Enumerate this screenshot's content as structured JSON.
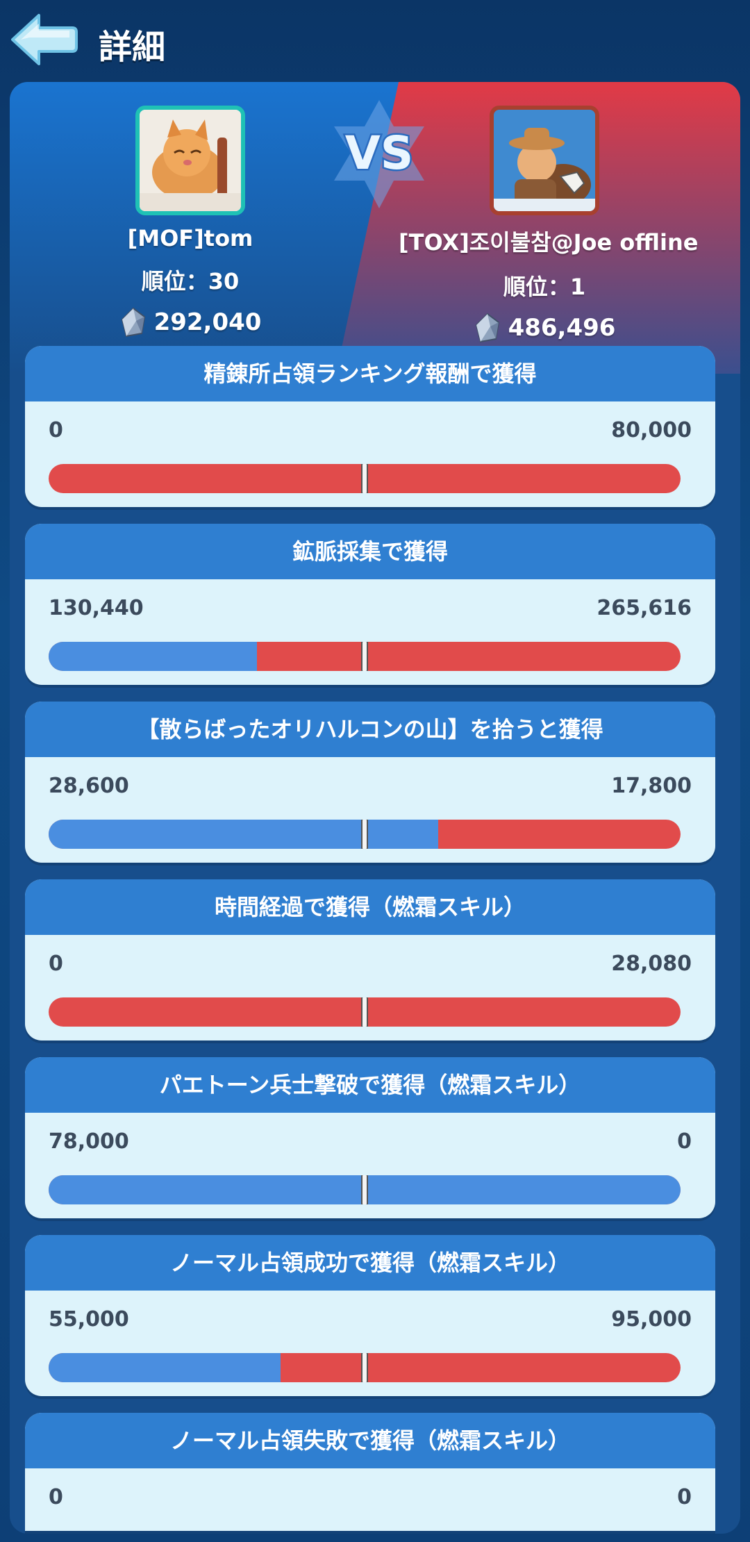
{
  "header": {
    "title": "詳細"
  },
  "players": {
    "left": {
      "name": "[MOF]tom",
      "rank": "順位：30",
      "score": "292,040"
    },
    "right": {
      "name": "[TOX]조이불참@Joe offline",
      "rank": "順位：1",
      "score": "486,496"
    }
  },
  "vs_label": "VS",
  "colors": {
    "blue": "#4a8ee0",
    "red": "#e14b4b",
    "header_blue": "#2f7fd1",
    "card_bg": "#ddf3fb"
  },
  "stats": [
    {
      "title": "精錬所占領ランキング報酬で獲得",
      "left_label": "0",
      "right_label": "80,000",
      "left_value": 0,
      "right_value": 80000
    },
    {
      "title": "鉱脈採集で獲得",
      "left_label": "130,440",
      "right_label": "265,616",
      "left_value": 130440,
      "right_value": 265616
    },
    {
      "title": "【散らばったオリハルコンの山】を拾うと獲得",
      "left_label": "28,600",
      "right_label": "17,800",
      "left_value": 28600,
      "right_value": 17800
    },
    {
      "title": "時間経過で獲得（燃霜スキル）",
      "left_label": "0",
      "right_label": "28,080",
      "left_value": 0,
      "right_value": 28080
    },
    {
      "title": "パエトーン兵士撃破で獲得（燃霜スキル）",
      "left_label": "78,000",
      "right_label": "0",
      "left_value": 78000,
      "right_value": 0
    },
    {
      "title": "ノーマル占領成功で獲得（燃霜スキル）",
      "left_label": "55,000",
      "right_label": "95,000",
      "left_value": 55000,
      "right_value": 95000
    },
    {
      "title": "ノーマル占領失敗で獲得（燃霜スキル）",
      "left_label": "0",
      "right_label": "0",
      "left_value": 0,
      "right_value": 0
    }
  ]
}
